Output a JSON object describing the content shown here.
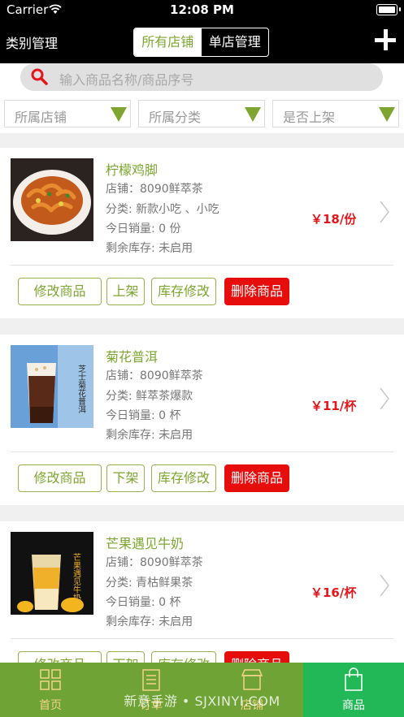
{
  "status_bar": {
    "carrier": "Carrier",
    "time": "12:08 PM"
  },
  "nav": {
    "left_title": "类别管理",
    "segments": [
      {
        "label": "所有店铺",
        "active": true
      },
      {
        "label": "单店管理",
        "active": false
      }
    ],
    "add_icon": "plus-icon"
  },
  "search": {
    "placeholder": "输入商品名称/商品序号",
    "icon": "search-icon"
  },
  "filters": [
    {
      "label": "所属店铺"
    },
    {
      "label": "所属分类"
    },
    {
      "label": "是否上架"
    }
  ],
  "products": [
    {
      "name": "柠檬鸡脚",
      "store": "店铺：8090鲜萃茶",
      "category": "分类:   新款小吃 、小吃",
      "sales": "今日销量:   0 份",
      "stock": "剩余库存:   未启用",
      "price": "￥18/份",
      "actions": {
        "edit": "修改商品",
        "shelf": "上架",
        "stock": "库存修改",
        "delete": "删除商品"
      }
    },
    {
      "name": "菊花普洱",
      "store": "店铺：8090鲜萃茶",
      "category": "分类:   鲜萃茶爆款",
      "sales": "今日销量:   0 杯",
      "stock": "剩余库存:   未启用",
      "price": "￥11/杯",
      "image_text": "芝士菊花普洱",
      "actions": {
        "edit": "修改商品",
        "shelf": "下架",
        "stock": "库存修改",
        "delete": "删除商品"
      }
    },
    {
      "name": "芒果遇见牛奶",
      "store": "店铺：8090鲜萃茶",
      "category": "分类:   青枯鲜果茶",
      "sales": "今日销量:   0 杯",
      "stock": "剩余库存:   未启用",
      "price": "￥16/杯",
      "image_text": "芒果遇见牛奶",
      "actions": {
        "edit": "修改商品",
        "shelf": "下架",
        "stock": "库存修改",
        "delete": "删除商品"
      }
    }
  ],
  "tabbar": [
    {
      "label": "首页",
      "icon": "grid-icon",
      "active": false
    },
    {
      "label": "订单",
      "icon": "document-icon",
      "active": false
    },
    {
      "label": "店铺",
      "icon": "store-icon",
      "active": false
    },
    {
      "label": "商品",
      "icon": "shopping-bag-icon",
      "active": true
    }
  ],
  "watermark": "新意手游 • SJXINYI.COM",
  "colors": {
    "accent_green": "#7da52f",
    "price_red": "#e4161a",
    "delete_red": "#e80d0d",
    "tabbar_green": "#6fa336",
    "tab_active": "#22b858"
  }
}
